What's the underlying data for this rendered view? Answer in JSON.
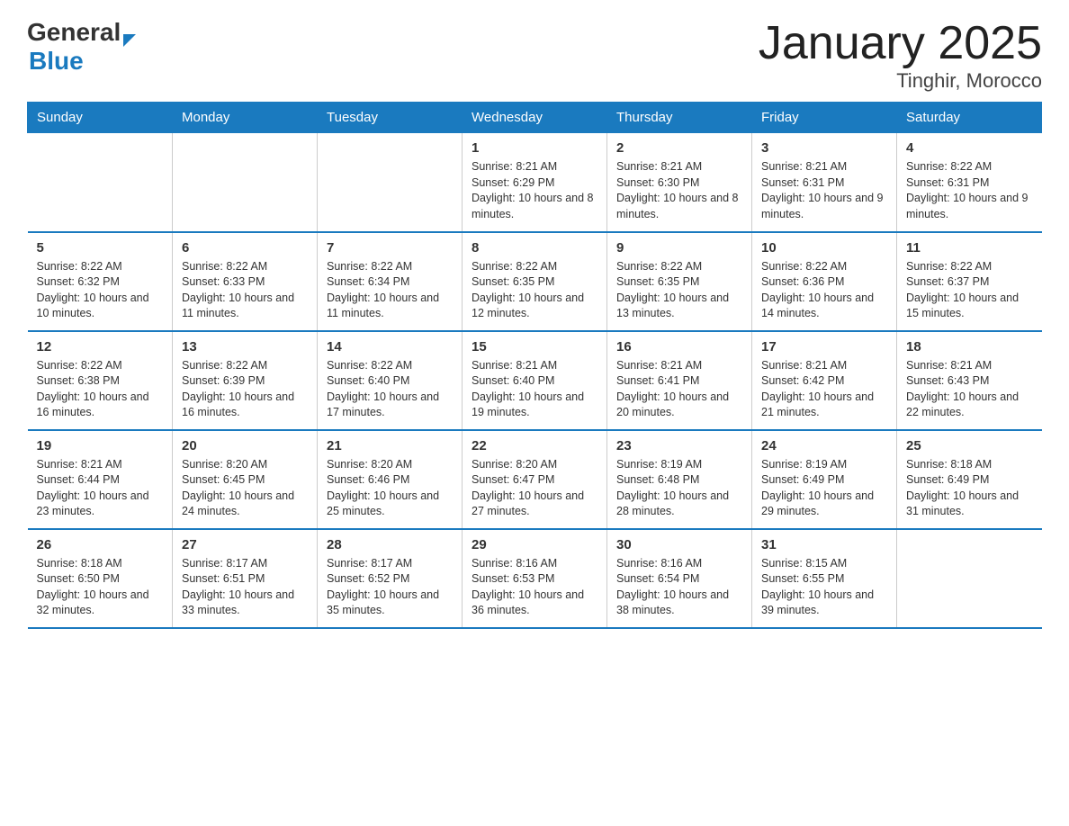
{
  "header": {
    "logo_general": "General",
    "logo_blue": "Blue",
    "title": "January 2025",
    "location": "Tinghir, Morocco"
  },
  "weekdays": [
    "Sunday",
    "Monday",
    "Tuesday",
    "Wednesday",
    "Thursday",
    "Friday",
    "Saturday"
  ],
  "weeks": [
    [
      {
        "day": "",
        "info": ""
      },
      {
        "day": "",
        "info": ""
      },
      {
        "day": "",
        "info": ""
      },
      {
        "day": "1",
        "info": "Sunrise: 8:21 AM\nSunset: 6:29 PM\nDaylight: 10 hours and 8 minutes."
      },
      {
        "day": "2",
        "info": "Sunrise: 8:21 AM\nSunset: 6:30 PM\nDaylight: 10 hours and 8 minutes."
      },
      {
        "day": "3",
        "info": "Sunrise: 8:21 AM\nSunset: 6:31 PM\nDaylight: 10 hours and 9 minutes."
      },
      {
        "day": "4",
        "info": "Sunrise: 8:22 AM\nSunset: 6:31 PM\nDaylight: 10 hours and 9 minutes."
      }
    ],
    [
      {
        "day": "5",
        "info": "Sunrise: 8:22 AM\nSunset: 6:32 PM\nDaylight: 10 hours and 10 minutes."
      },
      {
        "day": "6",
        "info": "Sunrise: 8:22 AM\nSunset: 6:33 PM\nDaylight: 10 hours and 11 minutes."
      },
      {
        "day": "7",
        "info": "Sunrise: 8:22 AM\nSunset: 6:34 PM\nDaylight: 10 hours and 11 minutes."
      },
      {
        "day": "8",
        "info": "Sunrise: 8:22 AM\nSunset: 6:35 PM\nDaylight: 10 hours and 12 minutes."
      },
      {
        "day": "9",
        "info": "Sunrise: 8:22 AM\nSunset: 6:35 PM\nDaylight: 10 hours and 13 minutes."
      },
      {
        "day": "10",
        "info": "Sunrise: 8:22 AM\nSunset: 6:36 PM\nDaylight: 10 hours and 14 minutes."
      },
      {
        "day": "11",
        "info": "Sunrise: 8:22 AM\nSunset: 6:37 PM\nDaylight: 10 hours and 15 minutes."
      }
    ],
    [
      {
        "day": "12",
        "info": "Sunrise: 8:22 AM\nSunset: 6:38 PM\nDaylight: 10 hours and 16 minutes."
      },
      {
        "day": "13",
        "info": "Sunrise: 8:22 AM\nSunset: 6:39 PM\nDaylight: 10 hours and 16 minutes."
      },
      {
        "day": "14",
        "info": "Sunrise: 8:22 AM\nSunset: 6:40 PM\nDaylight: 10 hours and 17 minutes."
      },
      {
        "day": "15",
        "info": "Sunrise: 8:21 AM\nSunset: 6:40 PM\nDaylight: 10 hours and 19 minutes."
      },
      {
        "day": "16",
        "info": "Sunrise: 8:21 AM\nSunset: 6:41 PM\nDaylight: 10 hours and 20 minutes."
      },
      {
        "day": "17",
        "info": "Sunrise: 8:21 AM\nSunset: 6:42 PM\nDaylight: 10 hours and 21 minutes."
      },
      {
        "day": "18",
        "info": "Sunrise: 8:21 AM\nSunset: 6:43 PM\nDaylight: 10 hours and 22 minutes."
      }
    ],
    [
      {
        "day": "19",
        "info": "Sunrise: 8:21 AM\nSunset: 6:44 PM\nDaylight: 10 hours and 23 minutes."
      },
      {
        "day": "20",
        "info": "Sunrise: 8:20 AM\nSunset: 6:45 PM\nDaylight: 10 hours and 24 minutes."
      },
      {
        "day": "21",
        "info": "Sunrise: 8:20 AM\nSunset: 6:46 PM\nDaylight: 10 hours and 25 minutes."
      },
      {
        "day": "22",
        "info": "Sunrise: 8:20 AM\nSunset: 6:47 PM\nDaylight: 10 hours and 27 minutes."
      },
      {
        "day": "23",
        "info": "Sunrise: 8:19 AM\nSunset: 6:48 PM\nDaylight: 10 hours and 28 minutes."
      },
      {
        "day": "24",
        "info": "Sunrise: 8:19 AM\nSunset: 6:49 PM\nDaylight: 10 hours and 29 minutes."
      },
      {
        "day": "25",
        "info": "Sunrise: 8:18 AM\nSunset: 6:49 PM\nDaylight: 10 hours and 31 minutes."
      }
    ],
    [
      {
        "day": "26",
        "info": "Sunrise: 8:18 AM\nSunset: 6:50 PM\nDaylight: 10 hours and 32 minutes."
      },
      {
        "day": "27",
        "info": "Sunrise: 8:17 AM\nSunset: 6:51 PM\nDaylight: 10 hours and 33 minutes."
      },
      {
        "day": "28",
        "info": "Sunrise: 8:17 AM\nSunset: 6:52 PM\nDaylight: 10 hours and 35 minutes."
      },
      {
        "day": "29",
        "info": "Sunrise: 8:16 AM\nSunset: 6:53 PM\nDaylight: 10 hours and 36 minutes."
      },
      {
        "day": "30",
        "info": "Sunrise: 8:16 AM\nSunset: 6:54 PM\nDaylight: 10 hours and 38 minutes."
      },
      {
        "day": "31",
        "info": "Sunrise: 8:15 AM\nSunset: 6:55 PM\nDaylight: 10 hours and 39 minutes."
      },
      {
        "day": "",
        "info": ""
      }
    ]
  ],
  "colors": {
    "header_bg": "#1a7abf",
    "header_text": "#ffffff",
    "border": "#1a7abf"
  }
}
